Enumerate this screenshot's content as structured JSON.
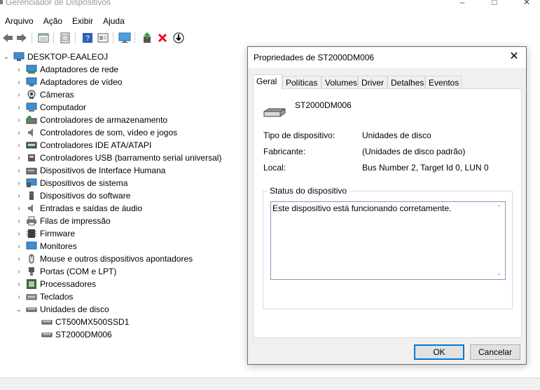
{
  "window": {
    "title": "Gerenciador de Dispositivos"
  },
  "menu": [
    "Arquivo",
    "Ação",
    "Exibir",
    "Ajuda"
  ],
  "toolbar": {
    "icons": [
      "back-icon",
      "forward-icon",
      "properties-icon",
      "show-hidden-icon",
      "help-icon",
      "details-icon",
      "monitor-icon",
      "update-driver-icon",
      "uninstall-icon",
      "disable-icon"
    ]
  },
  "tree": {
    "root": "DESKTOP-EAALEOJ",
    "categories": [
      "Adaptadores de rede",
      "Adaptadores de vídeo",
      "Câmeras",
      "Computador",
      "Controladores de armazenamento",
      "Controladores de som, vídeo e jogos",
      "Controladores IDE ATA/ATAPI",
      "Controladores USB (barramento serial universal)",
      "Dispositivos de Interface Humana",
      "Dispositivos de sistema",
      "Dispositivos do software",
      "Entradas e saídas de áudio",
      "Filas de impressão",
      "Firmware",
      "Monitores",
      "Mouse e outros dispositivos apontadores",
      "Portas (COM e LPT)",
      "Processadores",
      "Teclados",
      "Unidades de disco"
    ],
    "disk_children": [
      "CT500MX500SSD1",
      "ST2000DM006"
    ]
  },
  "dialog": {
    "title": "Propriedades de ST2000DM006",
    "close": "✕",
    "tabs": [
      "Geral",
      "Políticas",
      "Volumes",
      "Driver",
      "Detalhes",
      "Eventos"
    ],
    "device_name": "ST2000DM006",
    "fields": {
      "type_label": "Tipo de dispositivo:",
      "type_value": "Unidades de disco",
      "manufacturer_label": "Fabricante:",
      "manufacturer_value": "(Unidades de disco padrão)",
      "location_label": "Local:",
      "location_value": "Bus Number 2, Target Id 0, LUN 0"
    },
    "status_title": "Status do dispositivo",
    "status_text": "Este dispositivo está funcionando corretamente.",
    "ok": "OK",
    "cancel": "Cancelar"
  },
  "colors": {
    "accent": "#0078d7",
    "delete_red": "#e81123",
    "green": "#3a9a3a"
  }
}
